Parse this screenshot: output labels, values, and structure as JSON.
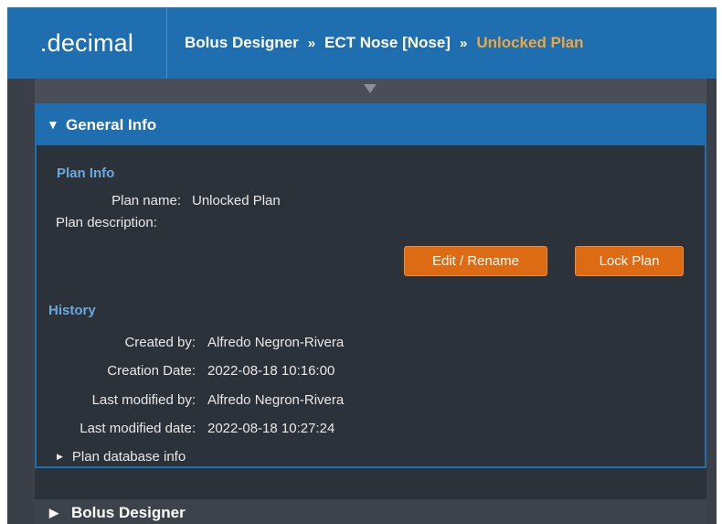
{
  "app": {
    "logo": ".decimal"
  },
  "breadcrumb": {
    "items": [
      "Bolus Designer",
      "ECT Nose [Nose]"
    ],
    "separator": "»",
    "current": "Unlocked Plan"
  },
  "general_info": {
    "header": "General Info",
    "plan_info": {
      "section_title": "Plan Info",
      "plan_name_label": "Plan name:",
      "plan_name_value": "Unlocked Plan",
      "plan_description_label": "Plan description:",
      "plan_description_value": ""
    },
    "buttons": {
      "edit": "Edit / Rename",
      "lock": "Lock Plan"
    },
    "history": {
      "section_title": "History",
      "created_by_label": "Created by:",
      "created_by_value": "Alfredo Negron-Rivera",
      "creation_date_label": "Creation Date:",
      "creation_date_value": "2022-08-18 10:16:00",
      "last_modified_by_label": "Last modified by:",
      "last_modified_by_value": "Alfredo Negron-Rivera",
      "last_modified_date_label": "Last modified date:",
      "last_modified_date_value": "2022-08-18 10:27:24"
    },
    "db_info": "Plan database info"
  },
  "bolus_designer": {
    "header": "Bolus Designer"
  },
  "colors": {
    "primary": "#1f6fb0",
    "accent": "#dd6b14",
    "highlight": "#f0a63a",
    "section": "#6aa8e0",
    "background": "#2c323a"
  }
}
